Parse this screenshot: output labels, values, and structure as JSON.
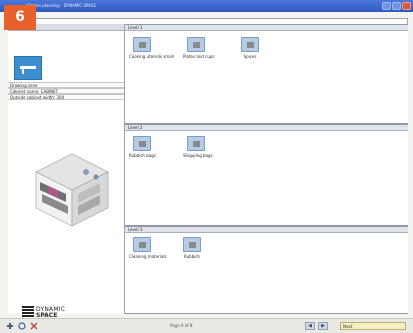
{
  "window": {
    "title": "Kitchen planning - DYNAMIC SPACE"
  },
  "step": {
    "number": "6"
  },
  "left_panel": {
    "properties": [
      "Drawing zone",
      "Cabinet name: CABINET",
      "Outside cabinet width: 300"
    ],
    "brand": {
      "line1": "DYNAMIC",
      "line2": "SPACE",
      "byline": "by Blum"
    }
  },
  "sections": [
    {
      "title": "Level 1",
      "items": [
        {
          "label": "Cooking utensils small",
          "icon": "cooking-utensils-icon"
        },
        {
          "label": "Plates and cups",
          "icon": "plates-icon"
        },
        {
          "label": "Spices",
          "icon": "spices-icon"
        }
      ]
    },
    {
      "title": "Level 2",
      "items": [
        {
          "label": "Rubbish bags",
          "icon": "rubbish-bags-icon"
        },
        {
          "label": "Shopping bags",
          "icon": "shopping-bags-icon"
        }
      ]
    },
    {
      "title": "Level 3",
      "items": [
        {
          "label": "Cleaning materials",
          "icon": "cleaning-icon"
        },
        {
          "label": "Rubbish",
          "icon": "rubbish-icon"
        }
      ]
    }
  ],
  "statusbar": {
    "page": "Page 6 of 8",
    "prev": "◀",
    "next": "▶",
    "field": "Next"
  }
}
